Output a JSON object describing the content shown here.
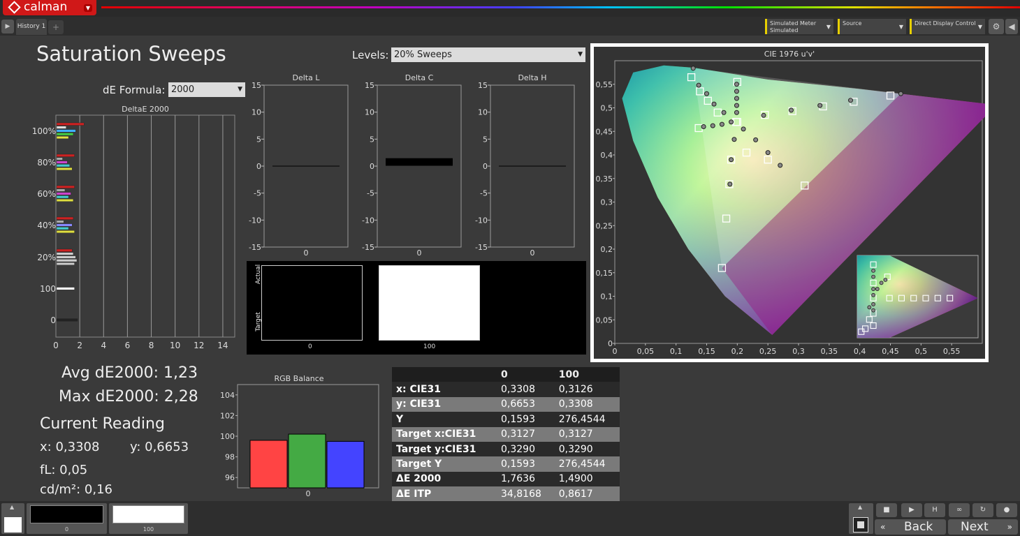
{
  "app": {
    "logo": "calman"
  },
  "tabs": {
    "history": "History 1",
    "add": "+"
  },
  "toolbar": {
    "meter_line1": "Simulated Meter",
    "meter_line2": "Simulated",
    "source": "Source",
    "ddc": "Direct Display Control"
  },
  "page": {
    "title": "Saturation Sweeps",
    "levels_label": "Levels:",
    "levels_value": "20% Sweeps",
    "de_formula_label": "dE Formula:",
    "de_formula_value": "2000"
  },
  "charts": {
    "deltae_title": "DeltaE 2000",
    "deltae_xticks": [
      "0",
      "2",
      "4",
      "6",
      "8",
      "10",
      "12",
      "14"
    ],
    "deltae_yticks": [
      "100%",
      "80%",
      "60%",
      "40%",
      "20%",
      "100",
      "0"
    ],
    "delta_l_title": "Delta L",
    "delta_c_title": "Delta C",
    "delta_h_title": "Delta H",
    "delta_yticks": [
      "15",
      "10",
      "5",
      "0",
      "-5",
      "-10",
      "-15"
    ],
    "delta_xtick": "0",
    "rgb_title": "RGB Balance",
    "rgb_yticks": [
      "104",
      "102",
      "100",
      "98",
      "96"
    ],
    "rgb_xtick": "0",
    "cie_title": "CIE 1976 u'v'",
    "cie_xticks": [
      "0",
      "0,05",
      "0,1",
      "0,15",
      "0,2",
      "0,25",
      "0,3",
      "0,35",
      "0,4",
      "0,45",
      "0,5",
      "0,55"
    ],
    "cie_yticks": [
      "0,55",
      "0,5",
      "0,45",
      "0,4",
      "0,35",
      "0,3",
      "0,25",
      "0,2",
      "0,15",
      "0,1",
      "0,05",
      "0"
    ]
  },
  "chart_data": [
    {
      "type": "bar",
      "title": "DeltaE 2000",
      "xlim": [
        0,
        15
      ],
      "groups": [
        "100%",
        "80%",
        "60%",
        "40%",
        "20%",
        "100",
        "0"
      ],
      "values": [
        [
          2.3,
          0.8,
          1.6,
          1.4,
          1.0
        ],
        [
          1.5,
          0.5,
          0.9,
          1.1,
          1.3
        ],
        [
          1.5,
          0.7,
          1.2,
          1.0,
          1.4
        ],
        [
          1.4,
          0.6,
          1.3,
          1.0,
          1.5
        ],
        [
          1.3,
          1.4,
          1.6,
          1.7,
          1.5
        ],
        [
          1.5
        ],
        [
          1.76
        ]
      ]
    },
    {
      "type": "bar",
      "title": "Delta L",
      "categories": [
        "0"
      ],
      "values": [
        0
      ],
      "ylim": [
        -15,
        15
      ]
    },
    {
      "type": "bar",
      "title": "Delta C",
      "categories": [
        "0"
      ],
      "values": [
        1.4
      ],
      "ylim": [
        -15,
        15
      ]
    },
    {
      "type": "bar",
      "title": "Delta H",
      "categories": [
        "0"
      ],
      "values": [
        0
      ],
      "ylim": [
        -15,
        15
      ]
    },
    {
      "type": "bar",
      "title": "RGB Balance",
      "categories": [
        "0"
      ],
      "series": [
        {
          "values": [
            99.6
          ]
        },
        {
          "values": [
            100.2
          ]
        },
        {
          "values": [
            99.5
          ]
        }
      ],
      "ylim": [
        95,
        105
      ]
    },
    {
      "type": "scatter",
      "title": "CIE 1976 u'v'",
      "xlim": [
        0,
        0.6
      ],
      "ylim": [
        0,
        0.6
      ],
      "series": [
        {
          "name": "target",
          "marker": "square",
          "points": [
            [
              0.125,
              0.565
            ],
            [
              0.139,
              0.535
            ],
            [
              0.152,
              0.515
            ],
            [
              0.168,
              0.49
            ],
            [
              0.2,
              0.555
            ],
            [
              0.2,
              0.47
            ],
            [
              0.198,
              0.47
            ],
            [
              0.137,
              0.457
            ],
            [
              0.187,
              0.338
            ],
            [
              0.182,
              0.265
            ],
            [
              0.175,
              0.16
            ],
            [
              0.245,
              0.485
            ],
            [
              0.29,
              0.493
            ],
            [
              0.34,
              0.503
            ],
            [
              0.39,
              0.513
            ],
            [
              0.45,
              0.526
            ],
            [
              0.19,
              0.39
            ],
            [
              0.215,
              0.405
            ],
            [
              0.25,
              0.39
            ],
            [
              0.31,
              0.335
            ]
          ]
        },
        {
          "name": "measured",
          "marker": "circle",
          "points": [
            [
              0.128,
              0.584
            ],
            [
              0.137,
              0.548
            ],
            [
              0.15,
              0.53
            ],
            [
              0.162,
              0.508
            ],
            [
              0.178,
              0.49
            ],
            [
              0.199,
              0.55
            ],
            [
              0.199,
              0.535
            ],
            [
              0.199,
              0.52
            ],
            [
              0.199,
              0.505
            ],
            [
              0.199,
              0.49
            ],
            [
              0.145,
              0.46
            ],
            [
              0.16,
              0.462
            ],
            [
              0.175,
              0.465
            ],
            [
              0.19,
              0.47
            ],
            [
              0.21,
              0.455
            ],
            [
              0.23,
              0.432
            ],
            [
              0.25,
              0.405
            ],
            [
              0.27,
              0.378
            ],
            [
              0.195,
              0.433
            ],
            [
              0.19,
              0.39
            ],
            [
              0.188,
              0.338
            ],
            [
              0.243,
              0.484
            ],
            [
              0.288,
              0.495
            ],
            [
              0.335,
              0.505
            ],
            [
              0.385,
              0.516
            ],
            [
              0.467,
              0.53
            ]
          ]
        }
      ]
    }
  ],
  "results": {
    "avg": "Avg dE2000: 1,23",
    "max": "Max dE2000: 2,28",
    "current_title": "Current Reading",
    "x": "x: 0,3308",
    "y": "y: 0,6653",
    "fl": "fL: 0,05",
    "cd": "cd/m²: 0,16"
  },
  "swatches": {
    "actual": "Actual",
    "target": "Target",
    "label_0": "0",
    "label_100": "100"
  },
  "table": {
    "headers": [
      "",
      "0",
      "100"
    ],
    "rows": [
      [
        "x: CIE31",
        "0,3308",
        "0,3126"
      ],
      [
        "y: CIE31",
        "0,6653",
        "0,3308"
      ],
      [
        "Y",
        "0,1593",
        "276,4544"
      ],
      [
        "Target x:CIE31",
        "0,3127",
        "0,3127"
      ],
      [
        "Target y:CIE31",
        "0,3290",
        "0,3290"
      ],
      [
        "Target Y",
        "0,1593",
        "276,4544"
      ],
      [
        "ΔE 2000",
        "1,7636",
        "1,4900"
      ],
      [
        "ΔE ITP",
        "34,8168",
        "0,8617"
      ]
    ]
  },
  "bottom": {
    "thumb0": "0",
    "thumb100": "100",
    "back": "Back",
    "next": "Next"
  },
  "colors": {
    "accent": "#d01818",
    "red": "#ff4444",
    "green": "#44aa44",
    "blue": "#4444ff"
  }
}
